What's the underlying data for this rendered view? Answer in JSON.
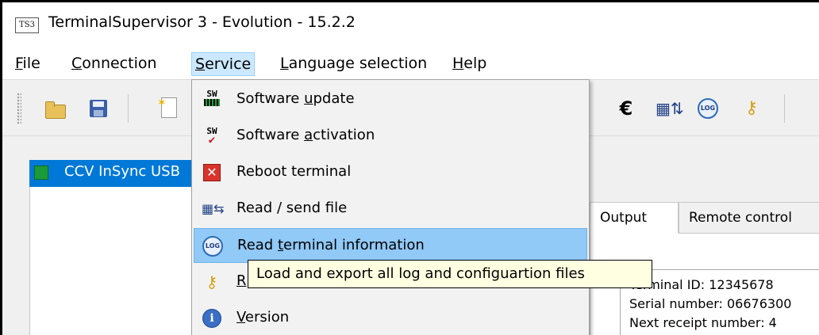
{
  "window": {
    "icon_text": "TS3",
    "title": "TerminalSupervisor 3 - Evolution - 15.2.2"
  },
  "menubar": {
    "items": [
      {
        "pre": "",
        "accel": "F",
        "post": "ile"
      },
      {
        "pre": "",
        "accel": "C",
        "post": "onnection"
      },
      {
        "pre": "",
        "accel": "S",
        "post": "ervice"
      },
      {
        "pre": "",
        "accel": "L",
        "post": "anguage selection"
      },
      {
        "pre": "",
        "accel": "H",
        "post": "elp"
      }
    ]
  },
  "toolbar": {
    "icons": [
      "open-folder-icon",
      "save-disk-icon",
      "new-document-icon",
      "euro-icon",
      "read-send-file-icon",
      "log-icon",
      "key-icon"
    ],
    "euro_glyph": "€",
    "log_glyph": "LOG"
  },
  "service_menu": {
    "items": [
      {
        "icon": "software-update-icon",
        "icon_text": "SW",
        "pre": "Software ",
        "accel": "u",
        "post": "pdate"
      },
      {
        "icon": "software-activation-icon",
        "icon_text": "SW",
        "pre": "Software ",
        "accel": "a",
        "post": "ctivation"
      },
      {
        "icon": "reboot-icon",
        "icon_text": "✕",
        "pre": "Reboot terminal",
        "accel": "",
        "post": ""
      },
      {
        "icon": "read-send-file-icon",
        "icon_text": "▦⇆",
        "pre": "Read / send file",
        "accel": "",
        "post": ""
      },
      {
        "icon": "log-icon",
        "icon_text": "LOG",
        "pre": "Read ",
        "accel": "t",
        "post": "erminal information"
      },
      {
        "icon": "key-icon",
        "icon_text": "⚷",
        "pre": "R",
        "accel": "",
        "post": ""
      },
      {
        "icon": "info-icon",
        "icon_text": "i",
        "pre": "",
        "accel": "V",
        "post": "ersion"
      }
    ],
    "hovered_index": 4
  },
  "tooltip": {
    "text": "Load and export all log and  configuartion files"
  },
  "session": {
    "label": "CCV InSync USB",
    "status_color": "#1a9a3a"
  },
  "right_panel": {
    "tabs": [
      "Output",
      "Remote control"
    ],
    "output_lines": [
      "Terminal ID: 12345678",
      "Serial number: 06676300",
      "Next receipt number: 4"
    ]
  },
  "colors": {
    "accent": "#0078d7",
    "hover": "#91c9f7",
    "tooltip_bg": "#ffffe1"
  }
}
